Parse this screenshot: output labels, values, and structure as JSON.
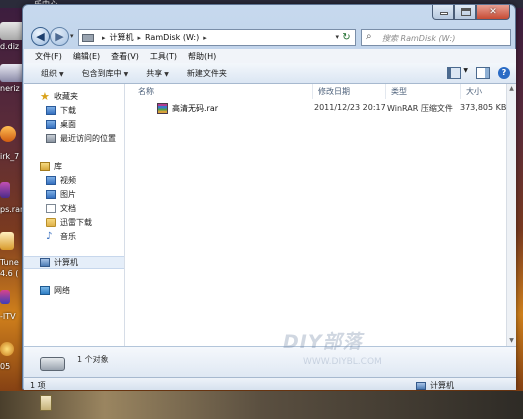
{
  "desktop": {
    "top_label": "乐中心",
    "icons": [
      {
        "label": "d.diz"
      },
      {
        "label": "neriz"
      },
      {
        "label": "irk_7"
      },
      {
        "label": "ps.rar"
      },
      {
        "label": "Tune"
      },
      {
        "label": "4.6 ("
      },
      {
        "label": "-ITV"
      },
      {
        "label": "05"
      }
    ]
  },
  "window": {
    "controls": {
      "minimize": "",
      "maximize": "",
      "close": "✕"
    },
    "address": {
      "crumbs": [
        "计算机",
        "RamDisk (W:)"
      ],
      "search_placeholder": "搜索 RamDisk (W:)"
    },
    "menu": [
      "文件(F)",
      "编辑(E)",
      "查看(V)",
      "工具(T)",
      "帮助(H)"
    ],
    "toolbar": {
      "organize": "组织",
      "include": "包含到库中",
      "share": "共享",
      "new_folder": "新建文件夹"
    },
    "nav": {
      "favorites": {
        "label": "收藏夹",
        "items": [
          "下载",
          "桌面",
          "最近访问的位置"
        ]
      },
      "libraries": {
        "label": "库",
        "items": [
          "视频",
          "图片",
          "文档",
          "迅雷下载",
          "音乐"
        ]
      },
      "computer": "计算机",
      "network": "网络"
    },
    "columns": [
      "名称",
      "修改日期",
      "类型",
      "大小"
    ],
    "files": [
      {
        "name": "高清无码.rar",
        "modified": "2011/12/23 20:17",
        "type": "WinRAR 压缩文件",
        "size": "373,805 KB"
      }
    ],
    "details": {
      "count": "1 个对象"
    },
    "status": {
      "items": "1 项",
      "location": "计算机"
    },
    "watermark": {
      "title": "DIY部落",
      "sub": "WWW.DIYBL.COM"
    }
  }
}
